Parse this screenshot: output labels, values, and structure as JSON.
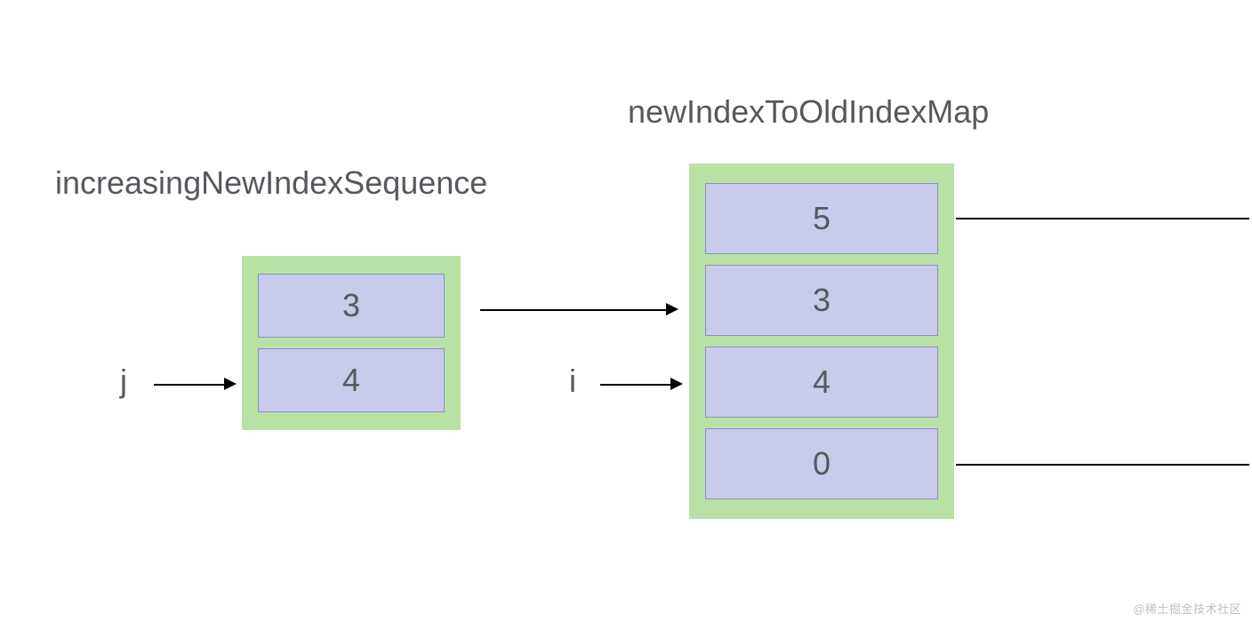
{
  "leftTitle": "increasingNewIndexSequence",
  "rightTitle": "newIndexToOldIndexMap",
  "jLabel": "j",
  "iLabel": "i",
  "leftBox": {
    "items": [
      "3",
      "4"
    ]
  },
  "rightBox": {
    "items": [
      "5",
      "3",
      "4",
      "0"
    ]
  },
  "watermark": "@稀土掘金技术社区",
  "colors": {
    "boxBg": "#b8e2a5",
    "cellBg": "#c9cbed",
    "text": "#55595d"
  }
}
